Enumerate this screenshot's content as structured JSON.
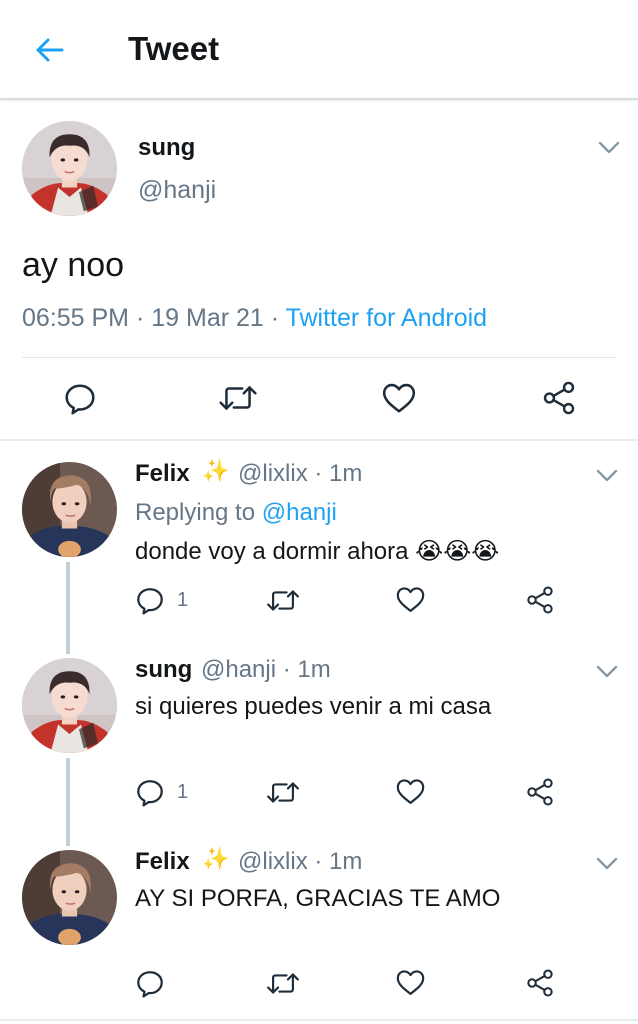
{
  "header": {
    "title": "Tweet"
  },
  "main_tweet": {
    "name": "sung",
    "handle": "@hanji",
    "text": "ay noo",
    "time": "06:55 PM",
    "date": "19 Mar 21",
    "source": "Twitter for Android",
    "separator": "·"
  },
  "replies": [
    {
      "name": "Felix",
      "badge": "✨",
      "handle": "@lixlix",
      "age": "1m",
      "replying_prefix": "Replying to",
      "replying_to": "@hanji",
      "text": "donde voy a dormir ahora",
      "emoji": "😭😭😭",
      "reply_count": "1"
    },
    {
      "name": "sung",
      "handle": "@hanji",
      "age": "1m",
      "text": "si quieres puedes venir a mi casa",
      "reply_count": "1"
    },
    {
      "name": "Felix",
      "badge": "✨",
      "handle": "@lixlix",
      "age": "1m",
      "text": "AY SI PORFA, GRACIAS TE AMO",
      "reply_count": ""
    }
  ],
  "colors": {
    "accent": "#1da1f2",
    "secondary_text": "#657786",
    "primary_text": "#14171a",
    "divider": "#e1e8ed"
  },
  "icons": [
    "back-arrow-icon",
    "chevron-down-icon",
    "reply-icon",
    "retweet-icon",
    "like-icon",
    "share-icon",
    "sparkles-icon",
    "crying-emoji-icon"
  ]
}
